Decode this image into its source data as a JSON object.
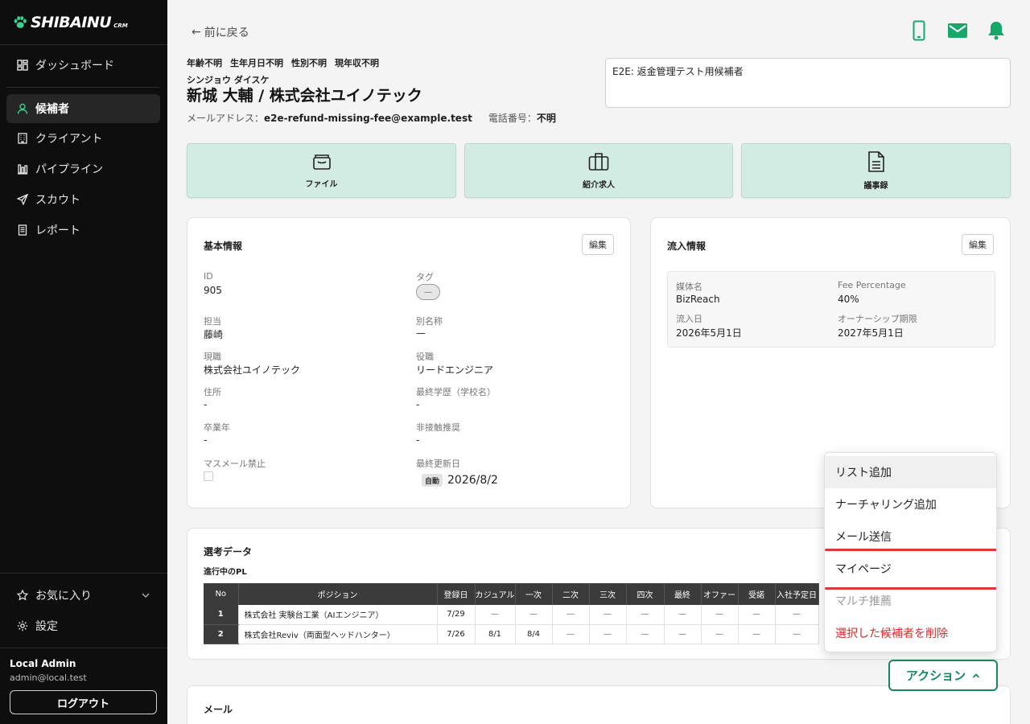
{
  "app": {
    "logo": "SHIBAINU",
    "logo_sub": "CRM"
  },
  "sidebar": {
    "items": [
      {
        "label": "ダッシュボード",
        "icon": "dashboard-icon"
      },
      {
        "label": "候補者",
        "icon": "user-icon",
        "active": true
      },
      {
        "label": "クライアント",
        "icon": "building-icon"
      },
      {
        "label": "パイプライン",
        "icon": "pipeline-icon"
      },
      {
        "label": "スカウト",
        "icon": "send-icon"
      },
      {
        "label": "レポート",
        "icon": "report-icon"
      }
    ],
    "favorites": "お気に入り",
    "settings": "設定",
    "user_name": "Local Admin",
    "user_email": "admin@local.test",
    "logout": "ログアウト"
  },
  "header": {
    "back": "前に戻る",
    "meta": [
      "年齢不明",
      "生年月日不明",
      "性別不明",
      "現年収不明"
    ],
    "kana": "シンジョウ ダイスケ",
    "name": "新城 大輔 / 株式会社ユイノテック",
    "email_label": "メールアドレス：",
    "email": "e2e-refund-missing-fee@example.test",
    "phone_label": "電話番号：",
    "phone": "不明",
    "memo": "E2E: 返金管理テスト用候補者"
  },
  "tiles": [
    {
      "label": "ファイル",
      "icon": "file-folder-icon"
    },
    {
      "label": "紹介求人",
      "icon": "briefcase-icon"
    },
    {
      "label": "議事録",
      "icon": "document-icon"
    }
  ],
  "basic": {
    "title": "基本情報",
    "edit": "編集",
    "fields": {
      "id_label": "ID",
      "id": "905",
      "tag_label": "タグ",
      "tag": "—",
      "owner_label": "担当",
      "owner": "藤崎",
      "alias_label": "別名称",
      "alias": "—",
      "current_label": "現職",
      "current": "株式会社ユイノテック",
      "role_label": "役職",
      "role": "リードエンジニア",
      "address_label": "住所",
      "address": "-",
      "edu_label": "最終学歴（学校名）",
      "edu": "-",
      "grad_label": "卒業年",
      "grad": "-",
      "nocontact_label": "非接触推奨",
      "nocontact": "-",
      "nomail_label": "マスメール禁止",
      "updated_label": "最終更新日",
      "auto": "自動",
      "updated": "2026/8/2"
    }
  },
  "inflow": {
    "title": "流入情報",
    "edit": "編集",
    "media_label": "媒体名",
    "media": "BizReach",
    "fee_label": "Fee Percentage",
    "fee": "40%",
    "date_label": "流入日",
    "date": "2026年5月1日",
    "owner_label": "オーナーシップ期限",
    "owner_date": "2027年5月1日"
  },
  "selection": {
    "title": "選考データ",
    "subtitle": "進行中のPL",
    "headers": [
      "No",
      "ポジション",
      "登録日",
      "カジュアル",
      "一次",
      "二次",
      "三次",
      "四次",
      "最終",
      "オファー",
      "受諾",
      "入社予定日"
    ],
    "rows": [
      [
        "1",
        "株式会社 実験台工業（AIエンジニア）",
        "7/29",
        "—",
        "—",
        "—",
        "—",
        "—",
        "—",
        "—",
        "—",
        "—"
      ],
      [
        "2",
        "株式会社Reviv（両面型ヘッドハンター）",
        "7/26",
        "8/1",
        "8/4",
        "—",
        "—",
        "—",
        "—",
        "—",
        "—",
        "—"
      ]
    ]
  },
  "mail": {
    "title": "メール"
  },
  "menu": {
    "items": [
      {
        "label": "リスト追加"
      },
      {
        "label": "ナーチャリング追加"
      },
      {
        "label": "メール送信"
      },
      {
        "label": "マイページ"
      },
      {
        "label": "マルチ推薦"
      },
      {
        "label": "選択した候補者を削除"
      }
    ]
  },
  "action": {
    "label": "アクション"
  },
  "colors": {
    "accent": "#15885c",
    "danger": "#d92b2b",
    "tile": "#d3ece3",
    "sidebar": "#0e0e0e"
  }
}
